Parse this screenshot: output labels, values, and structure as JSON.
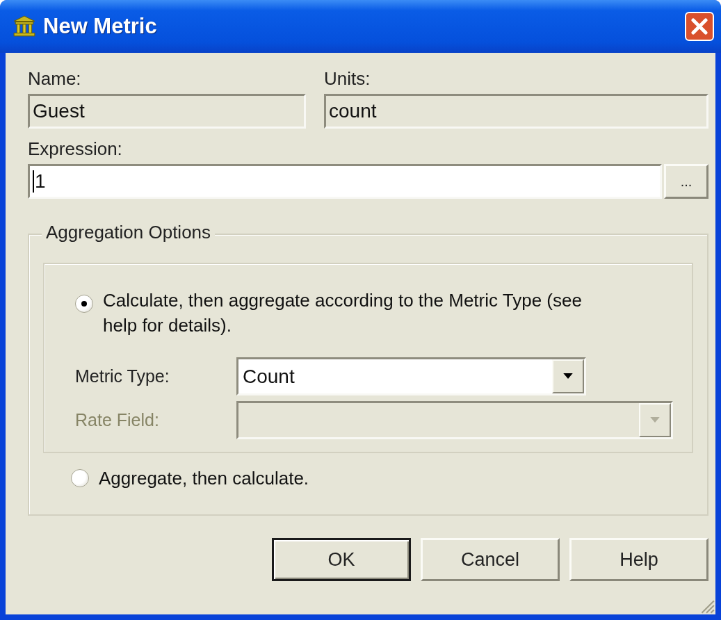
{
  "window": {
    "title": "New Metric"
  },
  "fields": [
    {
      "label": "Name:",
      "value": "Guest",
      "editable": false
    },
    {
      "label": "Units:",
      "value": "count",
      "editable": false
    }
  ],
  "expression": {
    "label": "Expression:",
    "value": "1",
    "browse_button": "..."
  },
  "aggregation": {
    "title": "Aggregation Options",
    "options": [
      {
        "label": "Calculate, then aggregate according to the Metric Type (see help for details).",
        "selected": true
      },
      {
        "label": "Aggregate, then calculate.",
        "selected": false
      }
    ],
    "metric_type": {
      "label": "Metric Type:",
      "value": "Count",
      "disabled": false
    },
    "rate_field": {
      "label": "Rate Field:",
      "disabled": true
    }
  },
  "buttons": [
    {
      "label": "OK",
      "default": true
    },
    {
      "label": "Cancel",
      "default": false
    },
    {
      "label": "Help",
      "default": false
    }
  ]
}
